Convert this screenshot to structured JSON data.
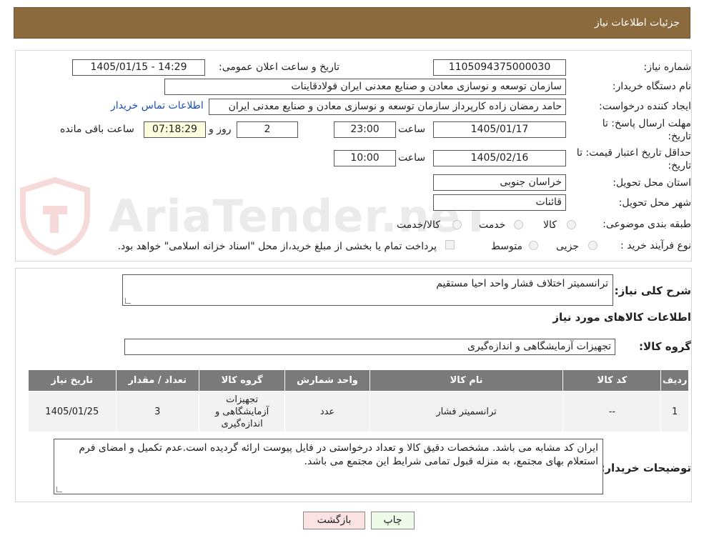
{
  "header": {
    "title": "جزئیات اطلاعات نیاز"
  },
  "form": {
    "need_number_label": "شماره نیاز:",
    "need_number": "1105094375000030",
    "announce_label": "تاریخ و ساعت اعلان عمومی:",
    "announce_value": "1405/01/15 - 14:29",
    "buyer_org_label": "نام دستگاه خریدار:",
    "buyer_org": "سازمان توسعه و نوسازی معادن و صنایع معدنی ایران فولادقاینات",
    "requester_label": "ایجاد کننده درخواست:",
    "requester": "حامد  رمضان زاده  کارپرداز  سازمان توسعه و نوسازی معادن و صنایع معدنی ایران",
    "contact_link": "اطلاعات تماس خریدار",
    "deadline_label_1": "مهلت ارسال پاسخ: تا",
    "deadline_label_2": "تاریخ:",
    "deadline_date": "1405/01/17",
    "time_label": "ساعت",
    "deadline_time": "23:00",
    "days_value": "2",
    "days_label": "روز و",
    "remaining_value": "07:18:29",
    "remaining_label": "ساعت باقی مانده",
    "validity_label_1": "حداقل تاریخ اعتبار قیمت: تا",
    "validity_label_2": "تاریخ:",
    "validity_date": "1405/02/16",
    "validity_time": "10:00",
    "province_label": "استان محل تحویل:",
    "province": "خراسان جنوبی",
    "city_label": "شهر محل تحویل:",
    "city": "قائنات",
    "category_label": "طبقه بندی موضوعی:",
    "category_options": [
      "کالا",
      "خدمت",
      "کالا/خدمت"
    ],
    "process_label": "نوع فرآیند خرید :",
    "process_options": [
      "جزیی",
      "متوسط"
    ],
    "payment_note": "پرداخت تمام یا بخشی از مبلغ خرید،از محل \"اسناد خزانه اسلامی\" خواهد بود."
  },
  "watermark": {
    "text": "AriaTender.neT"
  },
  "details": {
    "summary_label": "شرح کلی نیاز:",
    "summary": "ترانسمیتر اختلاف فشار واحد احیا مستقیم",
    "goods_info_title": "اطلاعات کالاهای مورد نیاز",
    "goods_group_label": "گروه کالا:",
    "goods_group": "تجهیزات آزمایشگاهی و اندازه‌گیری"
  },
  "table": {
    "headers": [
      "ردیف",
      "کد کالا",
      "نام کالا",
      "واحد شمارش",
      "گروه کالا",
      "تعداد / مقدار",
      "تاریخ نیاز"
    ],
    "rows": [
      [
        "1",
        "--",
        "ترانسمیتر فشار",
        "عدد",
        "تجهیزات آزمایشگاهی و اندازه‌گیری",
        "3",
        "1405/01/25"
      ]
    ]
  },
  "buyer_notes": {
    "label": "توضیحات خریدار:",
    "text": "ایران کد مشابه می باشد. مشخصات دقیق کالا و تعداد درخواستی در فایل پیوست ارائه گردیده است.عدم تکمیل و امضای فرم استعلام بهای مجتمع، به منزله قبول تمامی شرایط این مجتمع می باشد."
  },
  "buttons": {
    "print": "چاپ",
    "back": "بازگشت"
  },
  "colors": {
    "header_bg": "#8b6a3e",
    "table_header_bg": "#7a7a7a",
    "back_button_bg": "#fbe3e3",
    "print_button_bg": "#eefbe9"
  }
}
